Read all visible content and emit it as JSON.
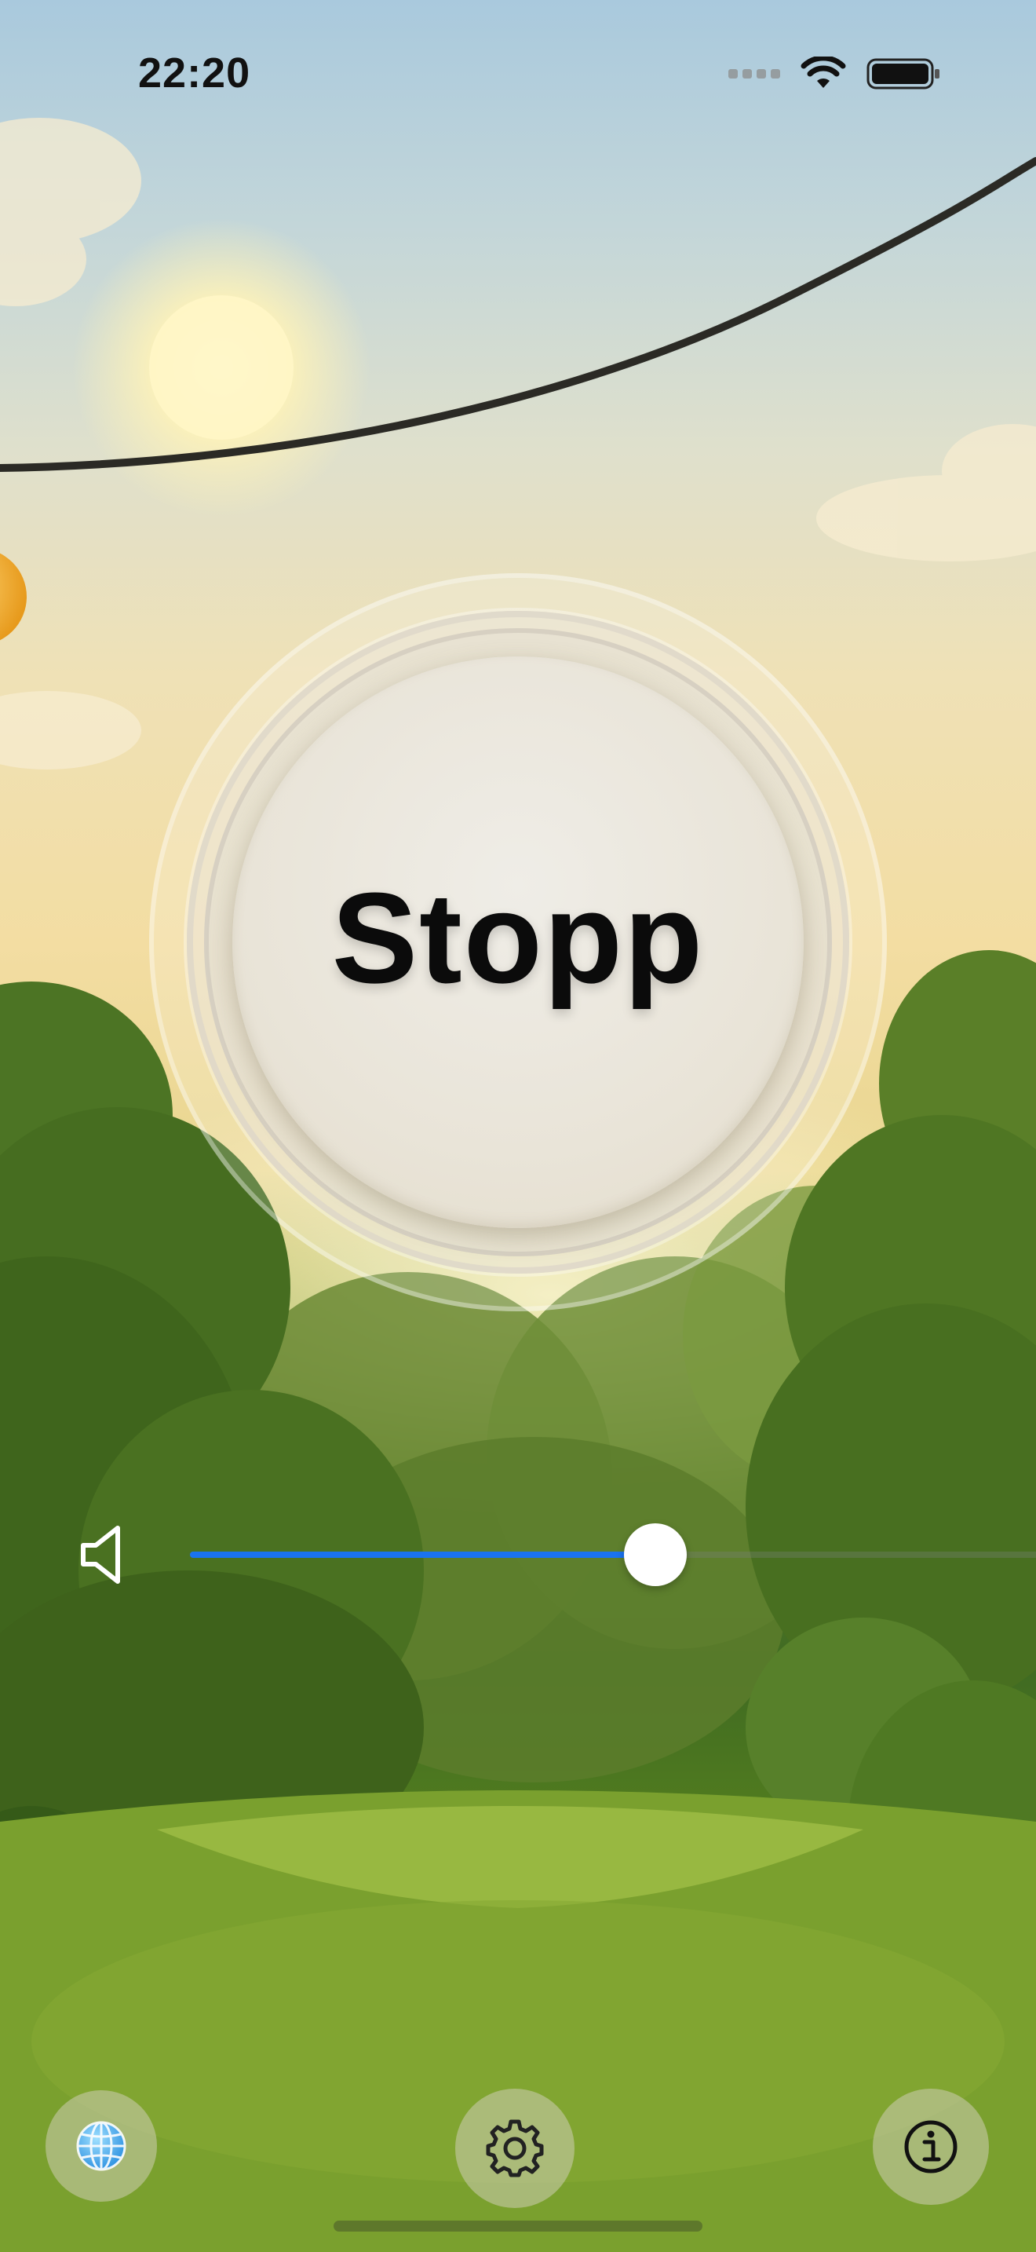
{
  "status_bar": {
    "time": "22:20"
  },
  "main": {
    "stop_button_label": "Stopp"
  },
  "volume": {
    "icon": "speaker-icon",
    "level": 0.53,
    "accent_color": "#1a73f0"
  },
  "bottom_bar": {
    "language_icon": "globe-icon",
    "settings_icon": "gear-icon",
    "info_icon": "info-icon"
  }
}
